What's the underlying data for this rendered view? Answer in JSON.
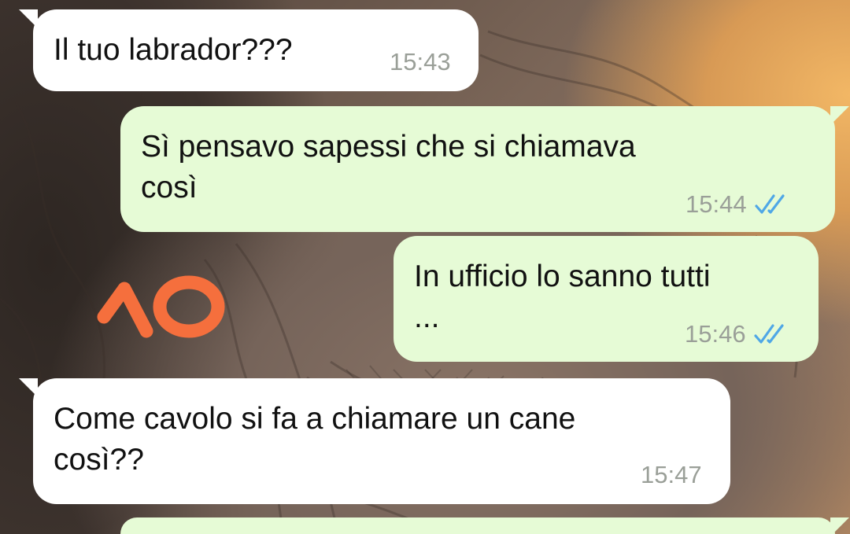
{
  "chat": {
    "messages": [
      {
        "direction": "incoming",
        "text": "Il tuo labrador???",
        "time": "15:43"
      },
      {
        "direction": "outgoing",
        "text": "Sì pensavo sapessi che si chiamava\ncosì",
        "time": "15:44",
        "status": "read",
        "status_icon": "double-check-icon"
      },
      {
        "direction": "outgoing",
        "text": "In ufficio lo sanno tutti\n...",
        "time": "15:46",
        "status": "read",
        "status_icon": "double-check-icon"
      },
      {
        "direction": "incoming",
        "text": "Come cavolo si fa a chiamare un cane\ncosì??",
        "time": "15:47"
      },
      {
        "direction": "outgoing",
        "text": "",
        "time": ""
      }
    ],
    "annotation": {
      "text": "10",
      "color": "#f56f3d"
    }
  },
  "colors": {
    "incoming_bubble": "#ffffff",
    "outgoing_bubble": "#e6fbd6",
    "timestamp": "#9a9f98",
    "read_ticks": "#4fa7e6"
  }
}
